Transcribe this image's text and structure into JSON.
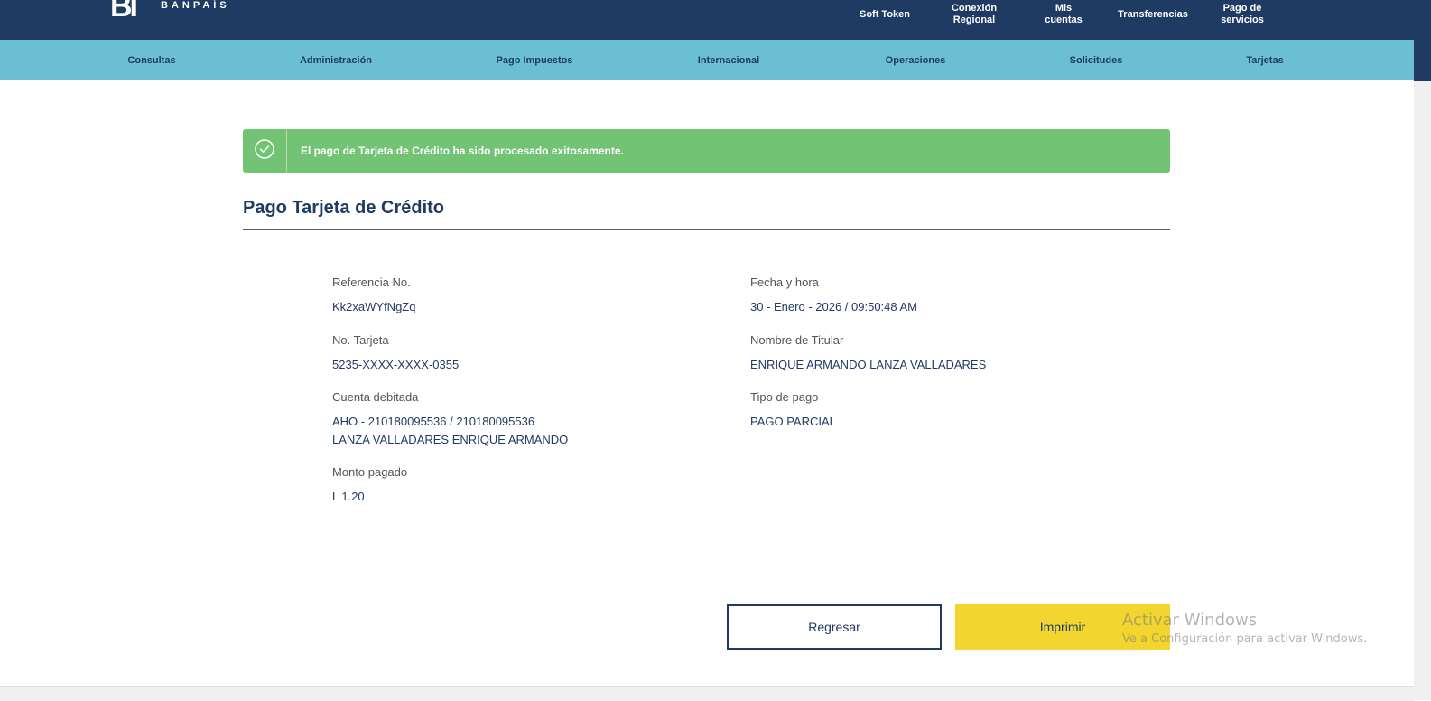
{
  "brand": {
    "logo_mark": "BI",
    "logo_text": "BANPAÍS"
  },
  "top_links": [
    {
      "label": "Soft Token"
    },
    {
      "label": "Conexión\nRegional"
    },
    {
      "label": "Mis\ncuentas"
    },
    {
      "label": "Transferencias"
    },
    {
      "label": "Pago de\nservicios"
    }
  ],
  "nav": {
    "items": [
      {
        "label": "Consultas"
      },
      {
        "label": "Administración"
      },
      {
        "label": "Pago Impuestos"
      },
      {
        "label": "Internacional"
      },
      {
        "label": "Operaciones"
      },
      {
        "label": "Solicitudes"
      },
      {
        "label": "Tarjetas"
      }
    ]
  },
  "alert": {
    "text": "El pago de Tarjeta de Crédito ha sido procesado exitosamente.",
    "color": "#72c374"
  },
  "page": {
    "title": "Pago Tarjeta de Crédito"
  },
  "details": {
    "reference": {
      "label": "Referencia No.",
      "value": "Kk2xaWYfNgZq"
    },
    "datetime": {
      "label": "Fecha y hora",
      "value": "30 - Enero - 2026 / 09:50:48 AM"
    },
    "card": {
      "label": "No. Tarjeta",
      "value": "5235-XXXX-XXXX-0355"
    },
    "holder": {
      "label": "Nombre de Titular",
      "value": "ENRIQUE ARMANDO LANZA VALLADARES"
    },
    "account": {
      "label": "Cuenta debitada",
      "value_line1": "AHO - 210180095536 / 210180095536",
      "value_line2": "LANZA VALLADARES ENRIQUE ARMANDO"
    },
    "payment_type": {
      "label": "Tipo de pago",
      "value": "PAGO PARCIAL"
    },
    "amount": {
      "label": "Monto pagado",
      "value": "L 1.20"
    }
  },
  "buttons": {
    "back": "Regresar",
    "print": "Imprimir"
  },
  "watermark": {
    "title": "Activar Windows",
    "subtitle": "Ve a Configuración para activar Windows."
  },
  "colors": {
    "primary": "#1f3b63",
    "nav": "#6bbfd2",
    "accent": "#f2d52e"
  }
}
